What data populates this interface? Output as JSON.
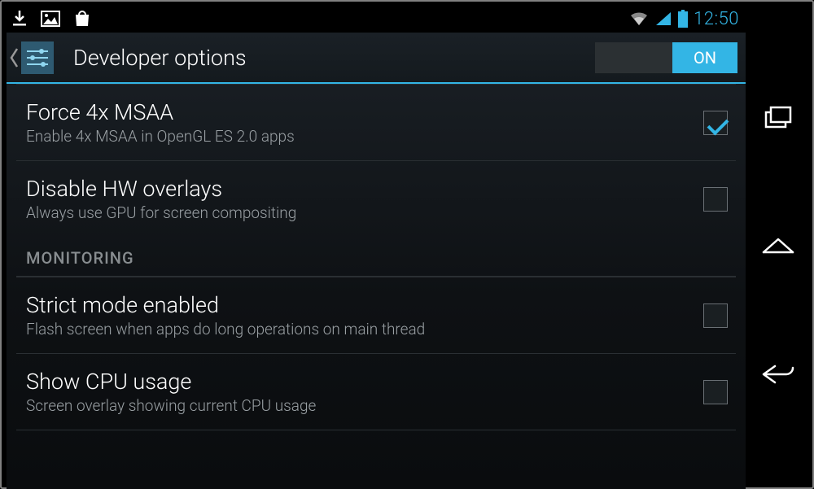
{
  "statusbar": {
    "clock": "12:50"
  },
  "actionbar": {
    "title": "Developer options",
    "switch_state": "ON"
  },
  "sections": [
    {
      "items": [
        {
          "title": "Force 4x MSAA",
          "subtitle": "Enable 4x MSAA in OpenGL ES 2.0 apps",
          "checked": true
        },
        {
          "title": "Disable HW overlays",
          "subtitle": "Always use GPU for screen compositing",
          "checked": false
        }
      ]
    },
    {
      "header": "MONITORING",
      "items": [
        {
          "title": "Strict mode enabled",
          "subtitle": "Flash screen when apps do long operations on main thread",
          "checked": false
        },
        {
          "title": "Show CPU usage",
          "subtitle": "Screen overlay showing current CPU usage",
          "checked": false
        }
      ]
    }
  ]
}
